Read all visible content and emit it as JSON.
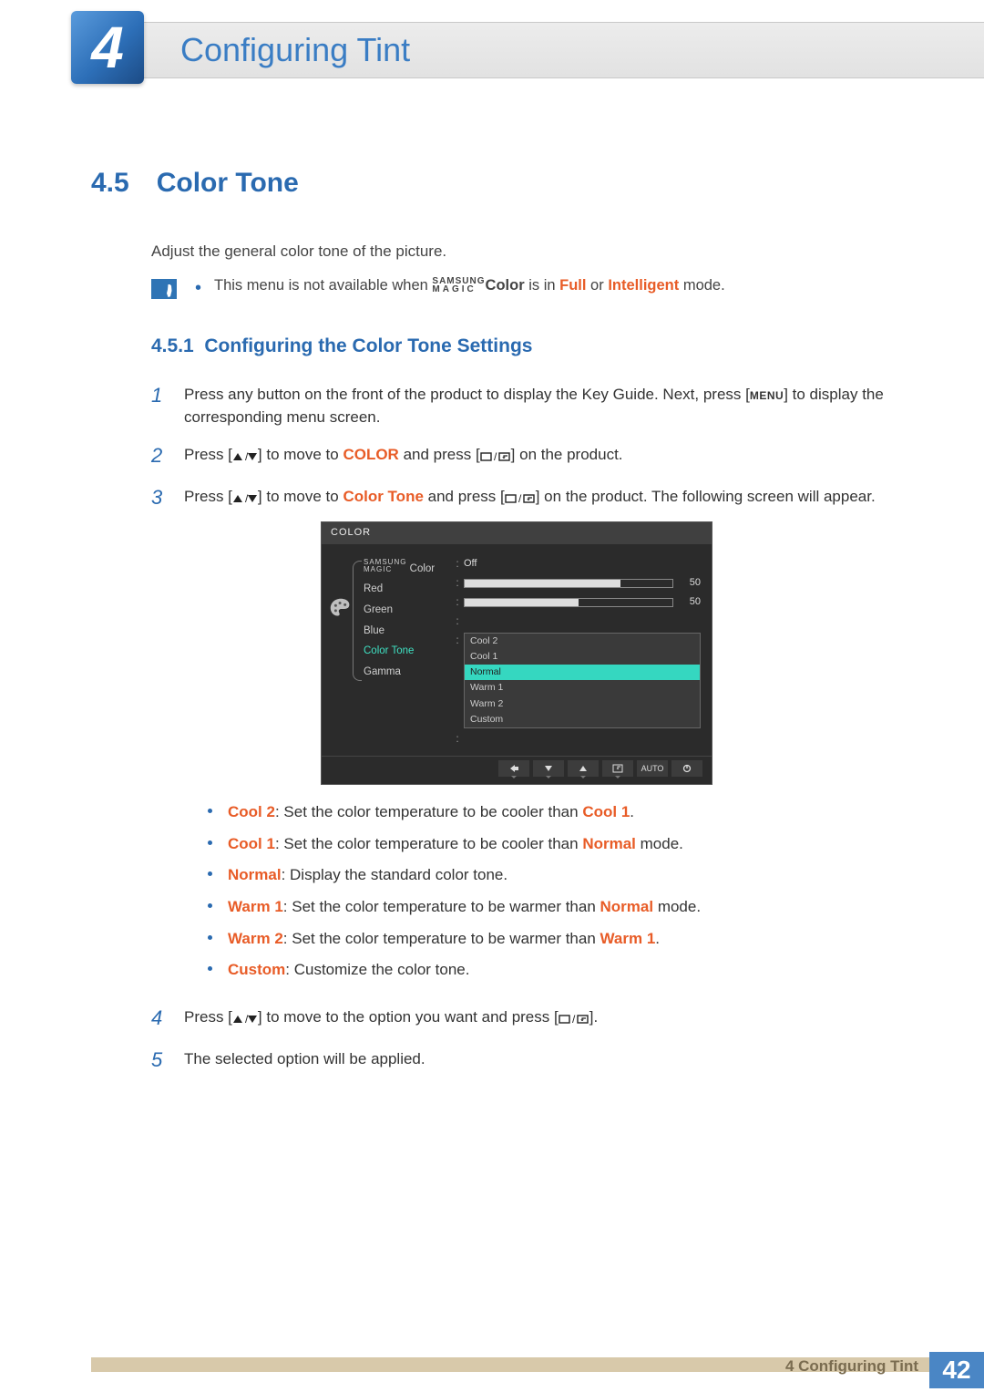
{
  "header": {
    "chapter_number": "4",
    "chapter_title": "Configuring Tint"
  },
  "section": {
    "number": "4.5",
    "title": "Color Tone",
    "intro": "Adjust the general color tone of the picture.",
    "note_prefix": "This menu is not available when ",
    "note_brand_top": "SAMSUNG",
    "note_brand_bottom": "MAGIC",
    "note_brand_word": "Color",
    "note_middle": " is in ",
    "note_full": "Full",
    "note_or": " or ",
    "note_intelligent": "Intelligent",
    "note_suffix": " mode."
  },
  "subsection": {
    "number": "4.5.1",
    "title": "Configuring the Color Tone Settings"
  },
  "steps": {
    "s1a": "Press any button on the front of the product to display the Key Guide. Next, press [",
    "s1_menu": "MENU",
    "s1b": "] to display the corresponding menu screen.",
    "s2a": "Press [",
    "s2b": "] to move to ",
    "s2_color": "COLOR",
    "s2c": " and press [",
    "s2d": "] on the product.",
    "s3a": "Press [",
    "s3b": "] to move to ",
    "s3_ct": "Color Tone",
    "s3c": " and press [",
    "s3d": "] on the product. The following screen will appear.",
    "s4a": "Press [",
    "s4b": "] to move to the option you want and press [",
    "s4c": "].",
    "s5": "The selected option will be applied."
  },
  "osd": {
    "title": "COLOR",
    "items": {
      "magic_top": "SAMSUNG",
      "magic_bottom": "MAGIC",
      "magic_label": " Color",
      "red": "Red",
      "green": "Green",
      "blue": "Blue",
      "color_tone": "Color Tone",
      "gamma": "Gamma"
    },
    "values": {
      "magic_color": "Off",
      "red": "50",
      "green": "50",
      "green_fill_pct": 55,
      "red_fill_pct": 75
    },
    "tone_options": [
      "Cool 2",
      "Cool 1",
      "Normal",
      "Warm 1",
      "Warm 2",
      "Custom"
    ],
    "tone_selected_index": 2,
    "footer_auto": "AUTO"
  },
  "bullets": {
    "cool2_k": "Cool 2",
    "cool2_t1": ": Set the color temperature to be cooler than ",
    "cool2_k2": "Cool 1",
    "cool2_t2": ".",
    "cool1_k": "Cool 1",
    "cool1_t1": ": Set the color temperature to be cooler than ",
    "cool1_k2": "Normal",
    "cool1_t2": " mode.",
    "normal_k": "Normal",
    "normal_t": ": Display the standard color tone.",
    "warm1_k": "Warm 1",
    "warm1_t1": ": Set the color temperature to be warmer than ",
    "warm1_k2": "Normal",
    "warm1_t2": " mode.",
    "warm2_k": "Warm 2",
    "warm2_t1": ": Set the color temperature to be warmer than ",
    "warm2_k2": "Warm 1",
    "warm2_t2": ".",
    "custom_k": "Custom",
    "custom_t": ": Customize the color tone."
  },
  "footer": {
    "label": "4 Configuring Tint",
    "page": "42"
  }
}
